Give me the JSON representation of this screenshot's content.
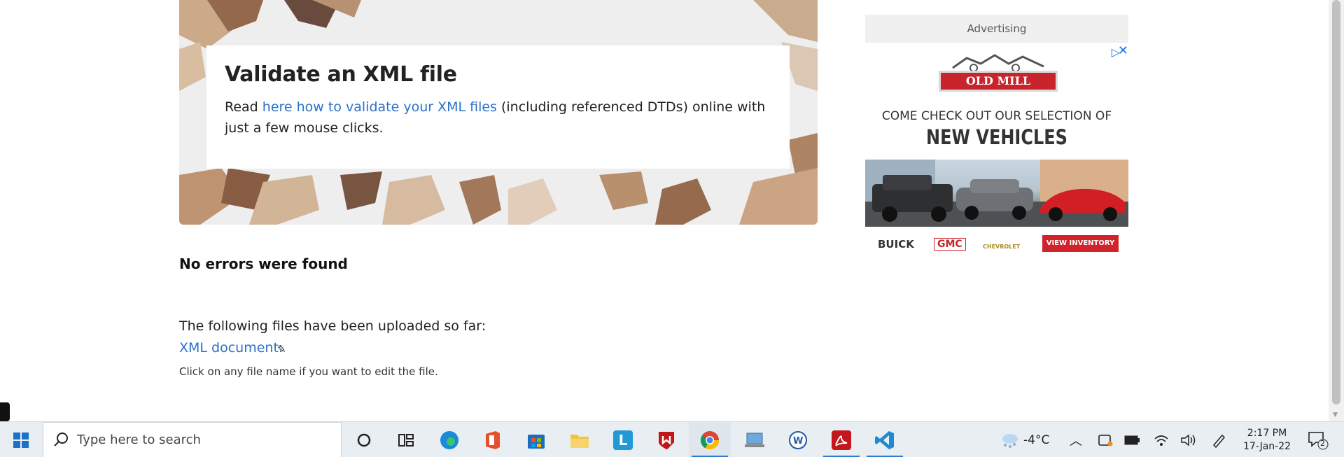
{
  "hero": {
    "title": "Validate an XML file",
    "text_before": "Read ",
    "link_text": "here how to validate your XML files",
    "text_after": " (including referenced DTDs) online with just a few mouse clicks."
  },
  "result": {
    "message": "No errors were found"
  },
  "files": {
    "intro": "The following files have been uploaded so far:",
    "xml_link": "XML document:",
    "hint": "Click on any file name if you want to edit the file."
  },
  "ad": {
    "header": "Advertising",
    "logo": "OLD MILL",
    "line1": "COME CHECK OUT OUR SELECTION OF",
    "line2": "NEW VEHICLES",
    "brands": [
      "BUICK",
      "GMC",
      "CHEVROLET"
    ],
    "cta": "VIEW INVENTORY"
  },
  "taskbar": {
    "search_placeholder": "Type here to search",
    "weather": "-4°C",
    "time": "2:17 PM",
    "date": "17-Jan-22",
    "notification_count": "2",
    "apps": [
      "cortana-icon",
      "task-view-icon",
      "edge-icon",
      "office-icon",
      "store-icon",
      "file-explorer-icon",
      "l-app-icon",
      "mcafee-icon",
      "chrome-icon",
      "remote-desktop-icon",
      "word-icon",
      "acrobat-icon",
      "vscode-icon"
    ]
  },
  "colors": {
    "link": "#2a72c9",
    "accent": "#2b7cd3",
    "ad_red": "#d0232c"
  }
}
